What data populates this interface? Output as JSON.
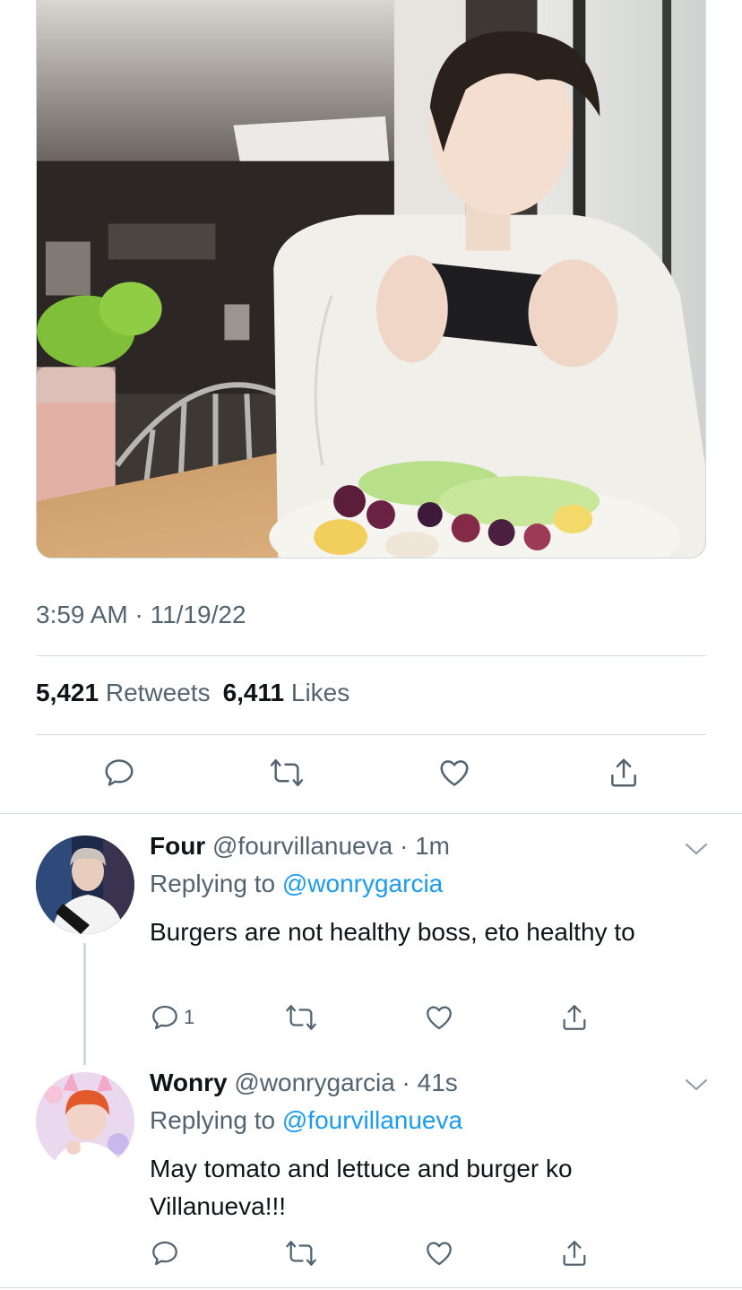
{
  "tweet": {
    "timestamp": "3:59 AM · 11/19/22",
    "retweets_count": "5,421",
    "retweets_label": "Retweets",
    "likes_count": "6,411",
    "likes_label": "Likes",
    "photo_description": "Young man in white sweater taking a photo with a phone at a cafe table with fruit bowl and pink drink"
  },
  "colors": {
    "accent": "#1d9bf0",
    "muted": "#536471",
    "text": "#0f1419",
    "divider": "#cfd9de"
  },
  "replies": [
    {
      "name": "Four",
      "meta": "@fourvillanueva · 1m",
      "replying_prefix": "Replying to",
      "replying_to": "@wonrygarcia",
      "text": "Burgers are not healthy boss, eto healthy to",
      "reply_count": "1"
    },
    {
      "name": "Wonry",
      "meta": "@wonrygarcia · 41s",
      "replying_prefix": "Replying to",
      "replying_to": "@fourvillanueva",
      "text": "May tomato and lettuce and burger ko Villanueva!!!",
      "reply_count": ""
    }
  ]
}
